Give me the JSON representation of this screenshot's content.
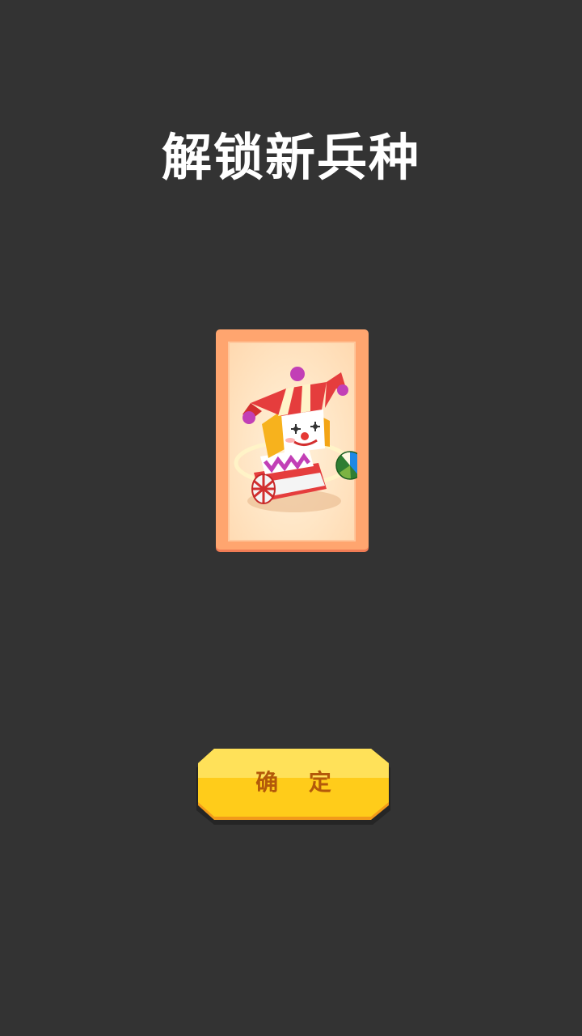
{
  "dialog": {
    "title": "解锁新兵种"
  },
  "card": {
    "unit_icon": "jack-in-the-box-clown-icon",
    "frame_color": "#ffa56f",
    "background_color": "#ffe5c4"
  },
  "confirm_button": {
    "label": "确 定",
    "color": "#ffc70f",
    "text_color": "#b3590a"
  }
}
